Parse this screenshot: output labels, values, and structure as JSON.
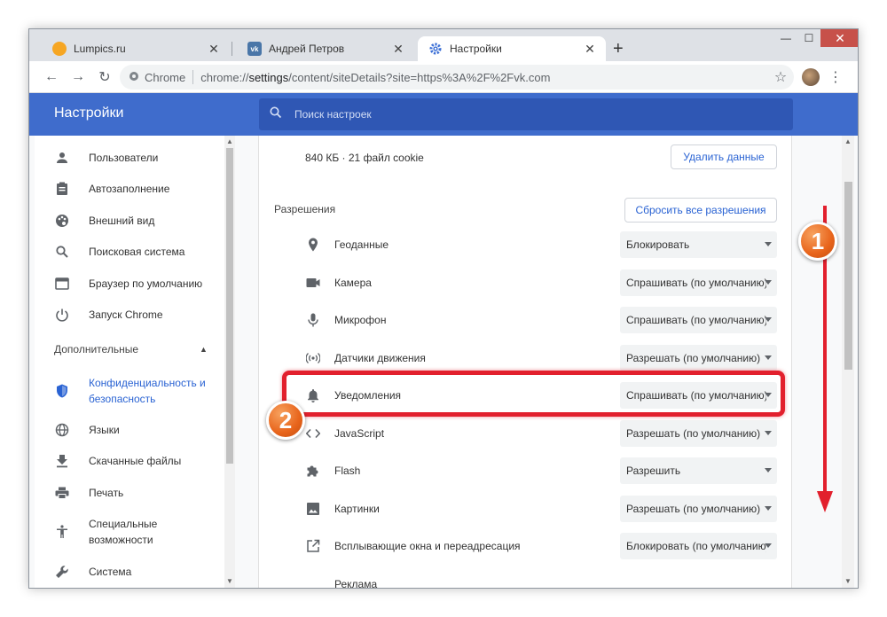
{
  "tabs": [
    {
      "title": "Lumpics.ru",
      "favicon": "lumpics-favicon"
    },
    {
      "title": "Андрей Петров",
      "favicon": "vk-favicon"
    },
    {
      "title": "Настройки",
      "favicon": "gear-icon"
    }
  ],
  "window_controls": {
    "minimize": "—",
    "maximize": "☐",
    "close": "✕"
  },
  "omnibox": {
    "chip": "Chrome",
    "url_prefix": "chrome://",
    "url_host": "settings",
    "url_rest": "/content/siteDetails?site=https%3A%2F%2Fvk.com"
  },
  "header": {
    "title": "Настройки",
    "search_placeholder": "Поиск настроек"
  },
  "sidebar": {
    "items": [
      {
        "label": "Пользователи",
        "icon": "person-icon"
      },
      {
        "label": "Автозаполнение",
        "icon": "clipboard-icon"
      },
      {
        "label": "Внешний вид",
        "icon": "palette-icon"
      },
      {
        "label": "Поисковая система",
        "icon": "search-icon"
      },
      {
        "label": "Браузер по умолчанию",
        "icon": "browser-icon"
      },
      {
        "label": "Запуск Chrome",
        "icon": "power-icon"
      }
    ],
    "section": "Дополнительные",
    "advanced_items": [
      {
        "label_line1": "Конфиденциальность и",
        "label_line2": "безопасность",
        "icon": "shield-icon"
      },
      {
        "label": "Языки",
        "icon": "globe-icon"
      },
      {
        "label": "Скачанные файлы",
        "icon": "download-icon"
      },
      {
        "label": "Печать",
        "icon": "printer-icon"
      },
      {
        "label_line1": "Специальные",
        "label_line2": "возможности",
        "icon": "accessibility-icon"
      },
      {
        "label": "Система",
        "icon": "wrench-icon"
      }
    ]
  },
  "site": {
    "usage": "840 КБ · 21 файл cookie",
    "clear_button": "Удалить данные",
    "permissions_title": "Разрешения",
    "reset_button": "Сбросить все разрешения"
  },
  "permissions": [
    {
      "label": "Геоданные",
      "value": "Блокировать",
      "icon": "location-icon"
    },
    {
      "label": "Камера",
      "value": "Спрашивать (по умолчанию)",
      "icon": "camera-icon"
    },
    {
      "label": "Микрофон",
      "value": "Спрашивать (по умолчанию)",
      "icon": "microphone-icon"
    },
    {
      "label": "Датчики движения",
      "value": "Разрешать (по умолчанию)",
      "icon": "sensors-icon"
    },
    {
      "label": "Уведомления",
      "value": "Спрашивать (по умолчанию)",
      "icon": "bell-icon"
    },
    {
      "label": "JavaScript",
      "value": "Разрешать (по умолчанию)",
      "icon": "code-icon"
    },
    {
      "label": "Flash",
      "value": "Разрешить",
      "icon": "puzzle-icon"
    },
    {
      "label": "Картинки",
      "value": "Разрешать (по умолчанию)",
      "icon": "image-icon"
    },
    {
      "label": "Всплывающие окна и переадресация",
      "value": "Блокировать (по умолчанию)",
      "icon": "popup-icon"
    },
    {
      "label": "Реклама",
      "value": "",
      "icon": ""
    }
  ],
  "annotations": {
    "badge1": "1",
    "badge2": "2",
    "color": "#e2202d"
  }
}
